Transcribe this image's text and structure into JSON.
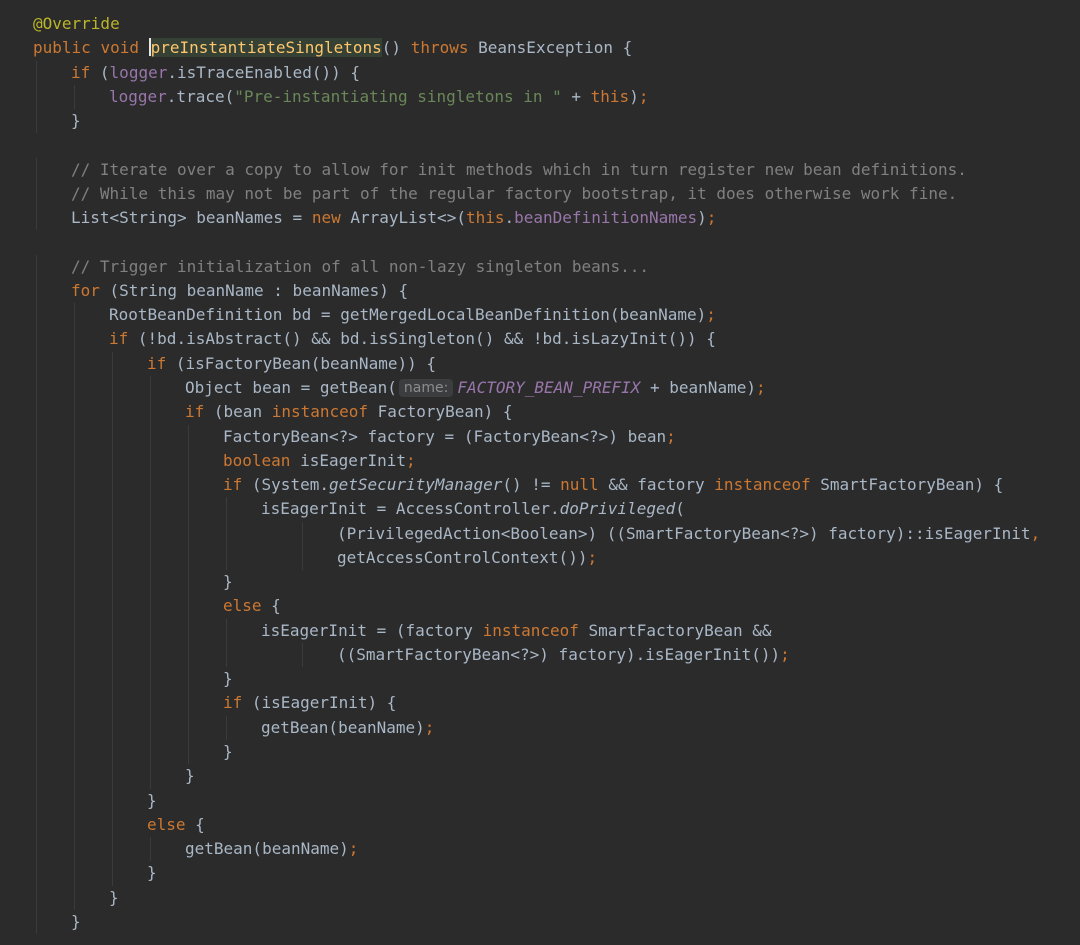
{
  "editor": {
    "theme": "darcula",
    "colors": {
      "background": "#2b2b2b",
      "text": "#a9b7c6",
      "keyword": "#cc7832",
      "annotation": "#bbb529",
      "string": "#6a8759",
      "comment": "#808080",
      "field": "#9876aa",
      "method_declaration": "#ffc66d",
      "param_hint_bg": "#3b3d3f"
    },
    "lines": [
      {
        "indent": 0,
        "tokens": [
          {
            "t": "@Override",
            "c": "ann"
          }
        ]
      },
      {
        "indent": 0,
        "tokens": [
          {
            "t": "public ",
            "c": "kw"
          },
          {
            "t": "void ",
            "c": "kw"
          },
          {
            "caret": true
          },
          {
            "t": "preInstantiateSingletons",
            "c": "fn-decl hl-word"
          },
          {
            "t": "() "
          },
          {
            "t": "throws ",
            "c": "kw"
          },
          {
            "t": "BeansException {"
          }
        ]
      },
      {
        "indent": 1,
        "tokens": [
          {
            "t": "if ",
            "c": "kw"
          },
          {
            "t": "("
          },
          {
            "t": "logger",
            "c": "fld"
          },
          {
            "t": ".isTraceEnabled()) {"
          }
        ]
      },
      {
        "indent": 2,
        "tokens": [
          {
            "t": "logger",
            "c": "fld"
          },
          {
            "t": ".trace("
          },
          {
            "t": "\"Pre-instantiating singletons in \"",
            "c": "str"
          },
          {
            "t": " + "
          },
          {
            "t": "this",
            "c": "kw"
          },
          {
            "t": ")"
          },
          {
            "t": ";",
            "c": "kw"
          }
        ]
      },
      {
        "indent": 1,
        "tokens": [
          {
            "t": "}"
          }
        ]
      },
      {
        "indent": 0,
        "tokens": []
      },
      {
        "indent": 1,
        "tokens": [
          {
            "t": "// Iterate over a copy to allow for init methods which in turn register new bean definitions.",
            "c": "cmt"
          }
        ]
      },
      {
        "indent": 1,
        "tokens": [
          {
            "t": "// While this may not be part of the regular factory bootstrap, it does otherwise work fine.",
            "c": "cmt"
          }
        ]
      },
      {
        "indent": 1,
        "tokens": [
          {
            "t": "List<String> beanNames = "
          },
          {
            "t": "new ",
            "c": "kw"
          },
          {
            "t": "ArrayList<>("
          },
          {
            "t": "this",
            "c": "kw"
          },
          {
            "t": "."
          },
          {
            "t": "beanDefinitionNames",
            "c": "fld"
          },
          {
            "t": ")"
          },
          {
            "t": ";",
            "c": "kw"
          }
        ]
      },
      {
        "indent": 0,
        "tokens": []
      },
      {
        "indent": 1,
        "tokens": [
          {
            "t": "// Trigger initialization of all non-lazy singleton beans...",
            "c": "cmt"
          }
        ]
      },
      {
        "indent": 1,
        "tokens": [
          {
            "t": "for ",
            "c": "kw"
          },
          {
            "t": "(String beanName : beanNames) {"
          }
        ]
      },
      {
        "indent": 2,
        "tokens": [
          {
            "t": "RootBeanDefinition bd = getMergedLocalBeanDefinition(beanName)"
          },
          {
            "t": ";",
            "c": "kw"
          }
        ]
      },
      {
        "indent": 2,
        "tokens": [
          {
            "t": "if ",
            "c": "kw"
          },
          {
            "t": "(!bd.isAbstract() && bd.isSingleton() && !bd.isLazyInit()) {"
          }
        ]
      },
      {
        "indent": 3,
        "tokens": [
          {
            "t": "if ",
            "c": "kw"
          },
          {
            "t": "(isFactoryBean(beanName)) {"
          }
        ]
      },
      {
        "indent": 4,
        "tokens": [
          {
            "t": "Object bean = getBean("
          },
          {
            "hint": "name:"
          },
          {
            "t": "FACTORY_BEAN_PREFIX",
            "c": "fld-i"
          },
          {
            "t": " + beanName)"
          },
          {
            "t": ";",
            "c": "kw"
          }
        ]
      },
      {
        "indent": 4,
        "tokens": [
          {
            "t": "if ",
            "c": "kw"
          },
          {
            "t": "(bean "
          },
          {
            "t": "instanceof ",
            "c": "kw"
          },
          {
            "t": "FactoryBean) {"
          }
        ]
      },
      {
        "indent": 5,
        "tokens": [
          {
            "t": "FactoryBean<?> factory = (FactoryBean<?>) bean"
          },
          {
            "t": ";",
            "c": "kw"
          }
        ]
      },
      {
        "indent": 5,
        "tokens": [
          {
            "t": "boolean ",
            "c": "kw"
          },
          {
            "t": "isEagerInit"
          },
          {
            "t": ";",
            "c": "kw"
          }
        ]
      },
      {
        "indent": 5,
        "tokens": [
          {
            "t": "if ",
            "c": "kw"
          },
          {
            "t": "(System."
          },
          {
            "t": "getSecurityManager",
            "c": "ital"
          },
          {
            "t": "() != "
          },
          {
            "t": "null ",
            "c": "kw"
          },
          {
            "t": "&& factory "
          },
          {
            "t": "instanceof ",
            "c": "kw"
          },
          {
            "t": "SmartFactoryBean) {"
          }
        ]
      },
      {
        "indent": 6,
        "tokens": [
          {
            "t": "isEagerInit = AccessController."
          },
          {
            "t": "doPrivileged",
            "c": "ital"
          },
          {
            "t": "("
          }
        ]
      },
      {
        "indent": 8,
        "tokens": [
          {
            "t": "(PrivilegedAction<Boolean>) ((SmartFactoryBean<?>) factory)::isEagerInit"
          },
          {
            "t": ",",
            "c": "kw"
          }
        ]
      },
      {
        "indent": 8,
        "tokens": [
          {
            "t": "getAccessControlContext())"
          },
          {
            "t": ";",
            "c": "kw"
          }
        ]
      },
      {
        "indent": 5,
        "tokens": [
          {
            "t": "}"
          }
        ]
      },
      {
        "indent": 5,
        "tokens": [
          {
            "t": "else ",
            "c": "kw"
          },
          {
            "t": "{"
          }
        ]
      },
      {
        "indent": 6,
        "tokens": [
          {
            "t": "isEagerInit = (factory "
          },
          {
            "t": "instanceof ",
            "c": "kw"
          },
          {
            "t": "SmartFactoryBean &&"
          }
        ]
      },
      {
        "indent": 8,
        "tokens": [
          {
            "t": "((SmartFactoryBean<?>) factory).isEagerInit())"
          },
          {
            "t": ";",
            "c": "kw"
          }
        ]
      },
      {
        "indent": 5,
        "tokens": [
          {
            "t": "}"
          }
        ]
      },
      {
        "indent": 5,
        "tokens": [
          {
            "t": "if ",
            "c": "kw"
          },
          {
            "t": "(isEagerInit) {"
          }
        ]
      },
      {
        "indent": 6,
        "tokens": [
          {
            "t": "getBean(beanName)"
          },
          {
            "t": ";",
            "c": "kw"
          }
        ]
      },
      {
        "indent": 5,
        "tokens": [
          {
            "t": "}"
          }
        ]
      },
      {
        "indent": 4,
        "tokens": [
          {
            "t": "}"
          }
        ]
      },
      {
        "indent": 3,
        "tokens": [
          {
            "t": "}"
          }
        ]
      },
      {
        "indent": 3,
        "tokens": [
          {
            "t": "else ",
            "c": "kw"
          },
          {
            "t": "{"
          }
        ]
      },
      {
        "indent": 4,
        "tokens": [
          {
            "t": "getBean(beanName)"
          },
          {
            "t": ";",
            "c": "kw"
          }
        ]
      },
      {
        "indent": 3,
        "tokens": [
          {
            "t": "}"
          }
        ]
      },
      {
        "indent": 2,
        "tokens": [
          {
            "t": "}"
          }
        ]
      },
      {
        "indent": 1,
        "tokens": [
          {
            "t": "}"
          }
        ]
      }
    ]
  }
}
